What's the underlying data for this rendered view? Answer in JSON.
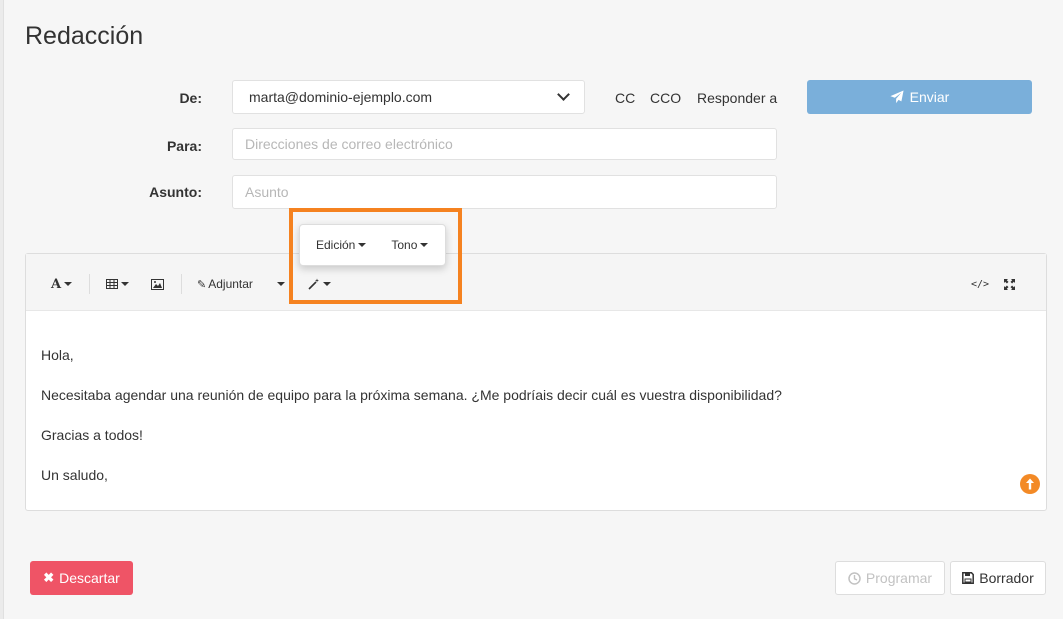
{
  "page": {
    "title": "Redacción"
  },
  "form": {
    "from_label": "De:",
    "from_value": "marta@dominio-ejemplo.com",
    "to_label": "Para:",
    "to_placeholder": "Direcciones de correo electrónico",
    "subject_label": "Asunto:",
    "subject_placeholder": "Asunto",
    "cc_label": "CC",
    "cco_label": "CCO",
    "reply_to_label": "Responder a",
    "send_label": "Enviar"
  },
  "toolbar": {
    "attach_label": "Adjuntar"
  },
  "popup": {
    "edit_label": "Edición",
    "tone_label": "Tono"
  },
  "message": {
    "lines": [
      "Hola,",
      "Necesitaba agendar una reunión de equipo para la próxima semana. ¿Me podríais decir cuál es vuestra disponibilidad?",
      "Gracias a todos!",
      "Un saludo,"
    ]
  },
  "footer": {
    "discard_label": "Descartar",
    "schedule_label": "Programar",
    "draft_label": "Borrador"
  },
  "colors": {
    "send_button": "#7aafda",
    "discard_button": "#ef5466",
    "highlight": "#f58220",
    "scroll_button": "#f38a26"
  }
}
